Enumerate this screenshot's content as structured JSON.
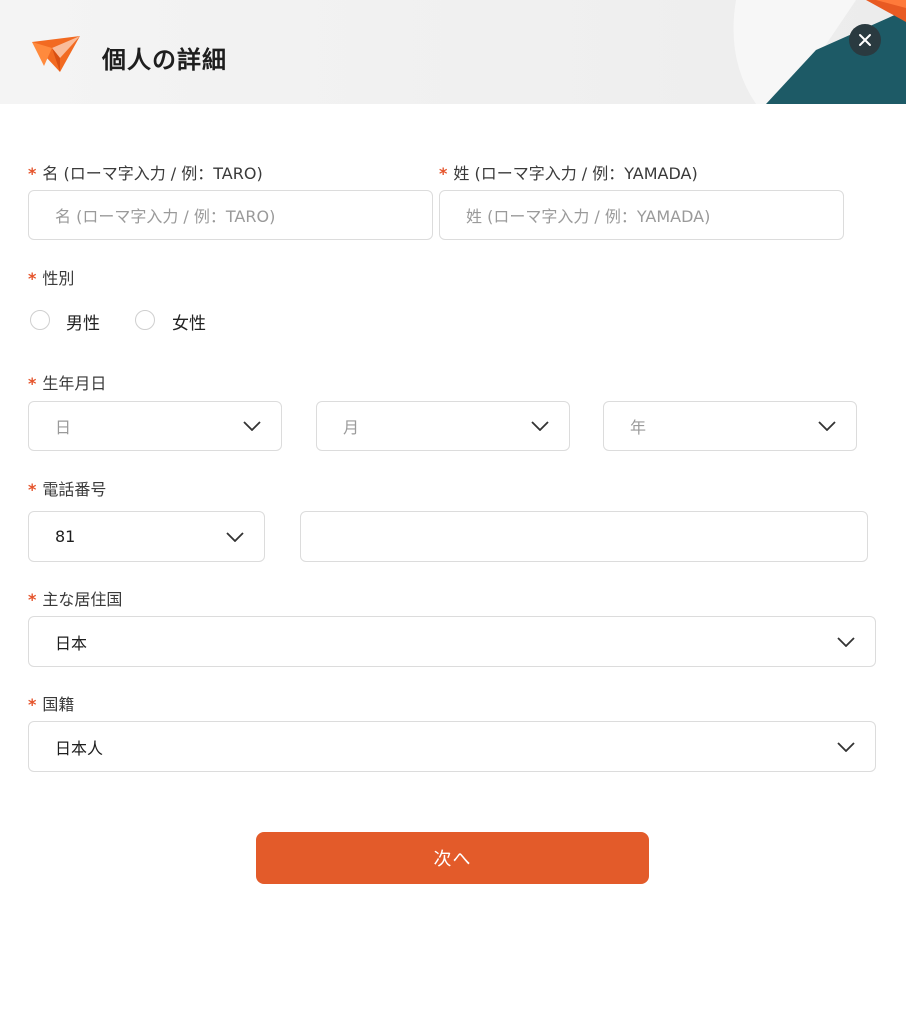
{
  "header": {
    "title": "個人の詳細"
  },
  "colors": {
    "accent": "#e35b2a",
    "required_mark": "#e5532a",
    "deco_teal": "#1d5a66",
    "close_bg": "#2a3a40"
  },
  "form": {
    "required_mark": "*",
    "first_name": {
      "label": "名 (ローマ字入力 / 例：TARO)",
      "placeholder": "名 (ローマ字入力 / 例：TARO)"
    },
    "last_name": {
      "label": "姓 (ローマ字入力 / 例：YAMADA)",
      "placeholder": "姓 (ローマ字入力 / 例：YAMADA)"
    },
    "gender": {
      "label": "性別",
      "options": [
        "男性",
        "女性"
      ]
    },
    "birthdate": {
      "label": "生年月日",
      "day_placeholder": "日",
      "month_placeholder": "月",
      "year_placeholder": "年"
    },
    "phone": {
      "label": "電話番号",
      "country_code": "81",
      "number": ""
    },
    "residence": {
      "label": "主な居住国",
      "value": "日本"
    },
    "nationality": {
      "label": "国籍",
      "value": "日本人"
    }
  },
  "footer": {
    "next_label": "次へ"
  }
}
